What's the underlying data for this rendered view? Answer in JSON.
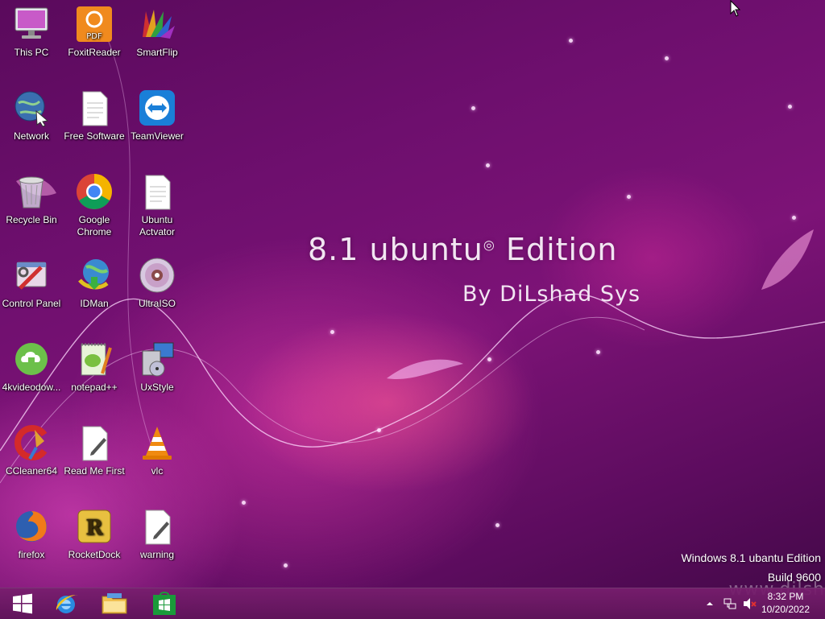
{
  "desktop": {
    "icons": [
      {
        "id": "this-pc",
        "label": "This PC"
      },
      {
        "id": "foxit-reader",
        "label": "FoxitReader"
      },
      {
        "id": "smartflip",
        "label": "SmartFlip"
      },
      {
        "id": "network",
        "label": "Network"
      },
      {
        "id": "free-software",
        "label": "Free Software"
      },
      {
        "id": "teamviewer",
        "label": "TeamViewer"
      },
      {
        "id": "recycle-bin",
        "label": "Recycle Bin"
      },
      {
        "id": "google-chrome",
        "label": "Google Chrome"
      },
      {
        "id": "ubuntu-actvator",
        "label": "Ubuntu Actvator"
      },
      {
        "id": "control-panel",
        "label": "Control Panel"
      },
      {
        "id": "idman",
        "label": "IDMan"
      },
      {
        "id": "ultraiso",
        "label": "UltraISO"
      },
      {
        "id": "4kvideodownloader",
        "label": "4kvideodow..."
      },
      {
        "id": "notepad-plus-plus",
        "label": "notepad++"
      },
      {
        "id": "uxstyle",
        "label": "UxStyle"
      },
      {
        "id": "ccleaner64",
        "label": "CCleaner64"
      },
      {
        "id": "read-me-first",
        "label": "Read Me First"
      },
      {
        "id": "vlc",
        "label": "vlc"
      },
      {
        "id": "firefox",
        "label": "firefox"
      },
      {
        "id": "rocketdock",
        "label": "RocketDock"
      },
      {
        "id": "warning",
        "label": "warning"
      }
    ]
  },
  "wallpaper": {
    "title_main": "8.1 ubuntu",
    "title_edition": "Edition",
    "subtitle": "By DiLshad Sys",
    "watermark_line1": "Windows 8.1 ubantu Edition",
    "watermark_line2": "Build 9600",
    "site_watermark": "www.dilsh"
  },
  "taskbar": {
    "start_icon": "windows-logo-icon",
    "pinned": [
      "internet-explorer-icon",
      "file-explorer-icon",
      "store-icon"
    ],
    "tray_icons": [
      "show-hidden-icons-chevron",
      "network-icon",
      "volume-muted-icon"
    ],
    "clock_time": "8:32 PM",
    "clock_date": "10/20/2022"
  },
  "colors": {
    "accent": "#7d1377",
    "taskbar": "#6a1764"
  }
}
